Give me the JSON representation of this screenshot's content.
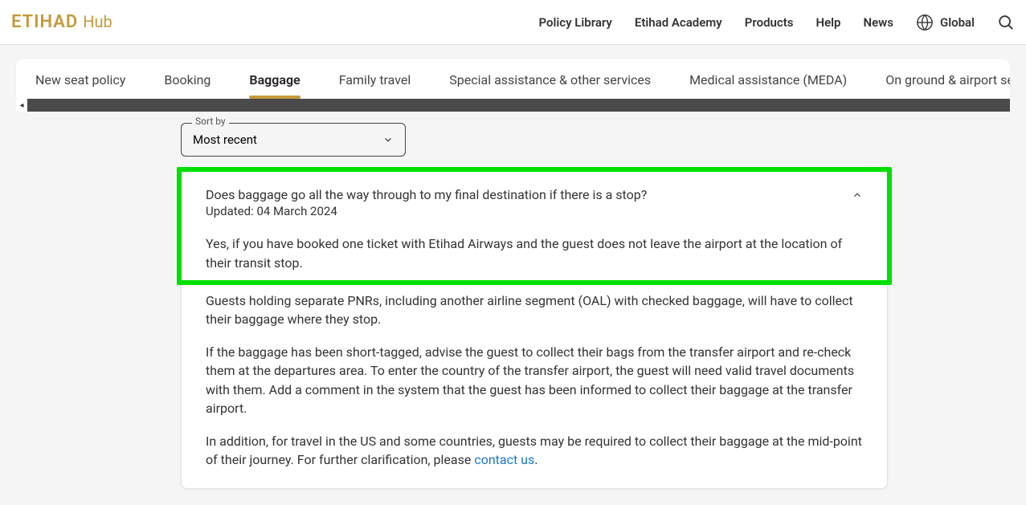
{
  "header": {
    "logo_main": "ETIHAD",
    "logo_sub": "Hub",
    "nav": {
      "policy": "Policy Library",
      "academy": "Etihad Academy",
      "products": "Products",
      "help": "Help",
      "news": "News",
      "global": "Global"
    }
  },
  "tabs": {
    "seat": "New seat policy",
    "booking": "Booking",
    "baggage": "Baggage",
    "family": "Family travel",
    "special": "Special assistance & other services",
    "medical": "Medical assistance (MEDA)",
    "ground": "On ground & airport servic"
  },
  "sort": {
    "label": "Sort by",
    "value": "Most recent"
  },
  "faq": {
    "question": "Does baggage go all the way through to my final destination if there is a stop?",
    "updated_label": "Updated: 04 March 2024",
    "p1": "Yes, if you have booked one ticket with Etihad Airways and the guest does not leave the airport at the location of their transit stop.",
    "p2": "Guests holding separate PNRs, including another airline segment (OAL) with checked baggage, will have to collect their baggage where they stop.",
    "p3": "If the baggage has been short-tagged, advise the guest to collect their bags from the transfer airport and re-check them at the departures area. To enter the country of the transfer airport, the guest will need valid travel documents with them. Add a comment in the system that the guest has been informed to collect their baggage at the transfer airport.",
    "p4_a": "In addition, for travel in the US and some countries, guests may be required to collect their baggage at the mid-point of their journey.  For further clarification, please ",
    "p4_link": "contact us",
    "p4_b": "."
  }
}
